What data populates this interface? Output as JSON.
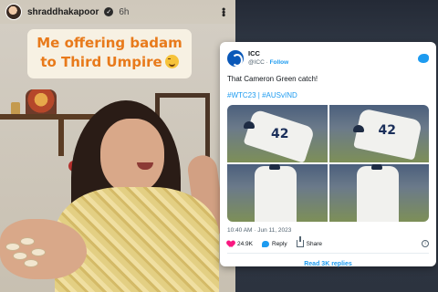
{
  "story": {
    "username": "shraddhakapoor",
    "time": "6h",
    "caption_line1": "Me offering badam",
    "caption_line2": "to Third Umpire"
  },
  "tweet": {
    "account_name": "ICC",
    "handle": "@ICC",
    "separator": " · ",
    "follow_label": "Follow",
    "text": "That Cameron Green catch!",
    "hashtags": "#WTC23 | #AUSvIND",
    "player_number": "42",
    "timestamp": "10:40 AM · Jun 11, 2023",
    "likes": "24.9K",
    "reply_label": "Reply",
    "share_label": "Share",
    "read_replies_label": "Read 3K replies",
    "accent_color": "#1d9bf0"
  }
}
